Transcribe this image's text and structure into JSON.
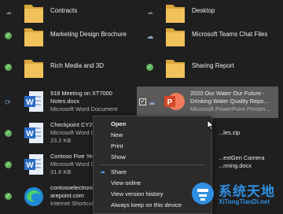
{
  "files": {
    "contracts": {
      "name": "Contracts",
      "icon": "folder-icon"
    },
    "desktop": {
      "name": "Desktop",
      "icon": "folder-icon"
    },
    "marketing": {
      "name": "Marketing Design Brochure",
      "icon": "folder-icon"
    },
    "teams_chat": {
      "name": "Microsoft Teams Chat Files",
      "icon": "folder-icon"
    },
    "rich_media": {
      "name": "Rich Media and 3D",
      "icon": "folder-icon"
    },
    "sharing_report": {
      "name": "Sharing Report",
      "icon": "folder-icon"
    },
    "meeting": {
      "line1": "918 Meeting on XT7000",
      "line2": "Notes.docx",
      "line3": "Microsoft Word Document",
      "icon": "word-doc-icon"
    },
    "water": {
      "line1": "2020 Our Water Our Future -",
      "line2": "Drinking Water Quality Repo...",
      "line3": "Microsoft PowerPoint Presen...",
      "icon": "powerpoint-icon"
    },
    "checkpoint": {
      "line1": "Checkpoint CY20",
      "line2": "Microsoft Word D",
      "line3": "23.2 KB",
      "icon": "word-doc-icon"
    },
    "zip": {
      "line1": "...les.zip"
    },
    "contoso_five": {
      "line1": "Contoso Five Yea",
      "line2": "Microsoft Word D",
      "line3": "31.6 KB",
      "icon": "word-doc-icon"
    },
    "nextgen": {
      "line1": "...extGen Camera",
      "line2": "...nning.docx"
    },
    "shortcut": {
      "line1": "contosoelectroni",
      "line2": "arepoint.com",
      "line3": "Internet Shortcut",
      "icon": "edge-icon"
    }
  },
  "context_menu": {
    "open": "Open",
    "new": "New",
    "print": "Print",
    "show": "Show",
    "share": "Share",
    "view_online": "View online",
    "version_history": "View version history",
    "keep_on_device": "Always keep on this device"
  },
  "watermark": {
    "title": "系统天地",
    "url": "XiTongTianDi.net"
  },
  "colors": {
    "background": "#1f1f1f",
    "folder": "#e8b54a",
    "word": "#2b6cc4",
    "powerpoint": "#d24726",
    "synced": "#5fb15a",
    "selection": "#5a5a5a",
    "watermark": "#2f8fe0"
  }
}
